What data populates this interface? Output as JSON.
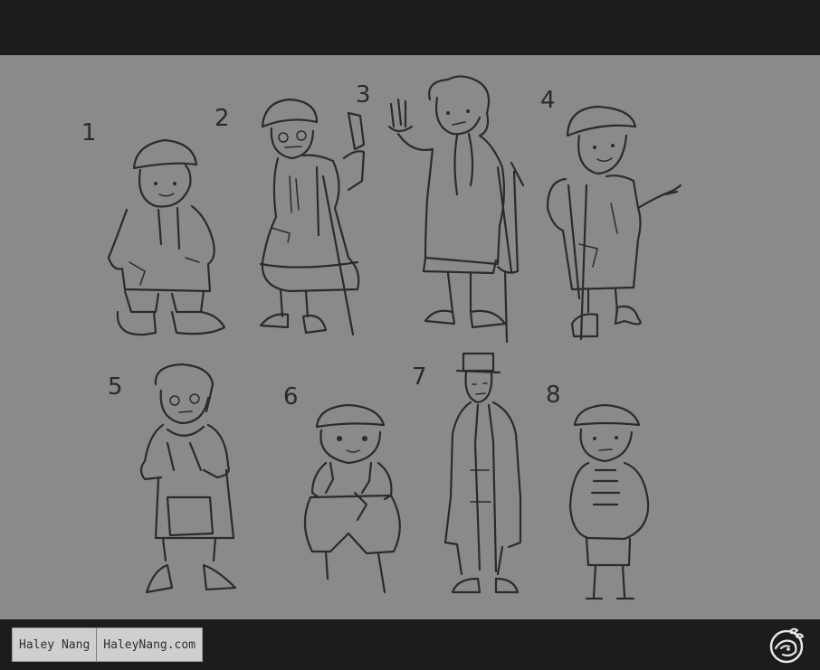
{
  "artwork": {
    "numbers": [
      "1",
      "2",
      "3",
      "4",
      "5",
      "6",
      "7",
      "8"
    ]
  },
  "credit": {
    "name": "Haley Nang",
    "site": "HaleyNang.com"
  },
  "logo": {
    "icon": "studio-logo-icon"
  }
}
